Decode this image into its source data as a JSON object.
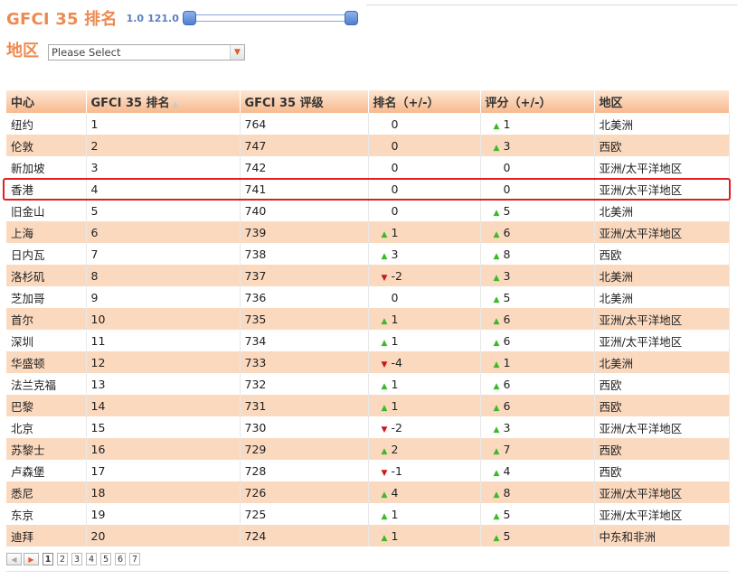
{
  "header": {
    "title": "GFCI 35 排名",
    "range_min": "1.0",
    "range_max": "121.0"
  },
  "filter": {
    "label": "地区",
    "select_value": "Please Select"
  },
  "table": {
    "columns": [
      "中心",
      "GFCI 35 排名",
      "GFCI 35 评级",
      "排名（+/-）",
      "评分（+/-）",
      "地区"
    ],
    "rows": [
      {
        "center": "纽约",
        "rank": "1",
        "rating": "764",
        "rank_dir": "flat",
        "rank_change": "0",
        "score_dir": "up",
        "score_change": "1",
        "region": "北美洲"
      },
      {
        "center": "伦敦",
        "rank": "2",
        "rating": "747",
        "rank_dir": "flat",
        "rank_change": "0",
        "score_dir": "up",
        "score_change": "3",
        "region": "西欧"
      },
      {
        "center": "新加坡",
        "rank": "3",
        "rating": "742",
        "rank_dir": "flat",
        "rank_change": "0",
        "score_dir": "flat",
        "score_change": "0",
        "region": "亚洲/太平洋地区"
      },
      {
        "center": "香港",
        "rank": "4",
        "rating": "741",
        "rank_dir": "flat",
        "rank_change": "0",
        "score_dir": "flat",
        "score_change": "0",
        "region": "亚洲/太平洋地区"
      },
      {
        "center": "旧金山",
        "rank": "5",
        "rating": "740",
        "rank_dir": "flat",
        "rank_change": "0",
        "score_dir": "up",
        "score_change": "5",
        "region": "北美洲"
      },
      {
        "center": "上海",
        "rank": "6",
        "rating": "739",
        "rank_dir": "up",
        "rank_change": "1",
        "score_dir": "up",
        "score_change": "6",
        "region": "亚洲/太平洋地区"
      },
      {
        "center": "日内瓦",
        "rank": "7",
        "rating": "738",
        "rank_dir": "up",
        "rank_change": "3",
        "score_dir": "up",
        "score_change": "8",
        "region": "西欧"
      },
      {
        "center": "洛杉矶",
        "rank": "8",
        "rating": "737",
        "rank_dir": "down",
        "rank_change": "-2",
        "score_dir": "up",
        "score_change": "3",
        "region": "北美洲"
      },
      {
        "center": "芝加哥",
        "rank": "9",
        "rating": "736",
        "rank_dir": "flat",
        "rank_change": "0",
        "score_dir": "up",
        "score_change": "5",
        "region": "北美洲"
      },
      {
        "center": "首尔",
        "rank": "10",
        "rating": "735",
        "rank_dir": "up",
        "rank_change": "1",
        "score_dir": "up",
        "score_change": "6",
        "region": "亚洲/太平洋地区"
      },
      {
        "center": "深圳",
        "rank": "11",
        "rating": "734",
        "rank_dir": "up",
        "rank_change": "1",
        "score_dir": "up",
        "score_change": "6",
        "region": "亚洲/太平洋地区"
      },
      {
        "center": "华盛顿",
        "rank": "12",
        "rating": "733",
        "rank_dir": "down",
        "rank_change": "-4",
        "score_dir": "up",
        "score_change": "1",
        "region": "北美洲"
      },
      {
        "center": "法兰克福",
        "rank": "13",
        "rating": "732",
        "rank_dir": "up",
        "rank_change": "1",
        "score_dir": "up",
        "score_change": "6",
        "region": "西欧"
      },
      {
        "center": "巴黎",
        "rank": "14",
        "rating": "731",
        "rank_dir": "up",
        "rank_change": "1",
        "score_dir": "up",
        "score_change": "6",
        "region": "西欧"
      },
      {
        "center": "北京",
        "rank": "15",
        "rating": "730",
        "rank_dir": "down",
        "rank_change": "-2",
        "score_dir": "up",
        "score_change": "3",
        "region": "亚洲/太平洋地区"
      },
      {
        "center": "苏黎士",
        "rank": "16",
        "rating": "729",
        "rank_dir": "up",
        "rank_change": "2",
        "score_dir": "up",
        "score_change": "7",
        "region": "西欧"
      },
      {
        "center": "卢森堡",
        "rank": "17",
        "rating": "728",
        "rank_dir": "down",
        "rank_change": "-1",
        "score_dir": "up",
        "score_change": "4",
        "region": "西欧"
      },
      {
        "center": "悉尼",
        "rank": "18",
        "rating": "726",
        "rank_dir": "up",
        "rank_change": "4",
        "score_dir": "up",
        "score_change": "8",
        "region": "亚洲/太平洋地区"
      },
      {
        "center": "东京",
        "rank": "19",
        "rating": "725",
        "rank_dir": "up",
        "rank_change": "1",
        "score_dir": "up",
        "score_change": "5",
        "region": "亚洲/太平洋地区"
      },
      {
        "center": "迪拜",
        "rank": "20",
        "rating": "724",
        "rank_dir": "up",
        "rank_change": "1",
        "score_dir": "up",
        "score_change": "5",
        "region": "中东和非洲"
      }
    ]
  },
  "pagination": {
    "pages": [
      "1",
      "2",
      "3",
      "4",
      "5",
      "6",
      "7"
    ],
    "current": "1"
  },
  "colors": {
    "accent": "#ee8a4f",
    "row_alt": "#fbd9bf",
    "up": "#3cb828",
    "down": "#c8181a",
    "highlight": "#e11e1e"
  }
}
